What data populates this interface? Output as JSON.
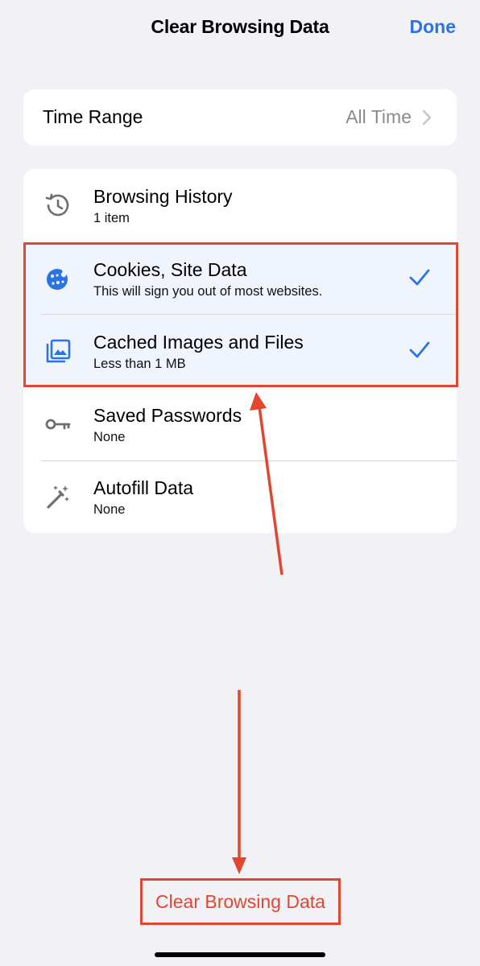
{
  "header": {
    "title": "Clear Browsing Data",
    "done_label": "Done"
  },
  "time_range": {
    "label": "Time Range",
    "value": "All Time"
  },
  "data_items": [
    {
      "title": "Browsing History",
      "subtitle": "1 item",
      "icon": "history-icon",
      "checked": false
    },
    {
      "title": "Cookies, Site Data",
      "subtitle": "This will sign you out of most websites.",
      "icon": "cookie-icon",
      "checked": true
    },
    {
      "title": "Cached Images and Files",
      "subtitle": "Less than 1 MB",
      "icon": "images-icon",
      "checked": true
    },
    {
      "title": "Saved Passwords",
      "subtitle": "None",
      "icon": "key-icon",
      "checked": false
    },
    {
      "title": "Autofill Data",
      "subtitle": "None",
      "icon": "magic-wand-icon",
      "checked": false
    }
  ],
  "footer": {
    "clear_label": "Clear Browsing Data"
  },
  "colors": {
    "accent": "#2a73e6",
    "annotation": "#e3452f",
    "icon_gray": "#6e6e73",
    "background": "#f2f2f6"
  }
}
